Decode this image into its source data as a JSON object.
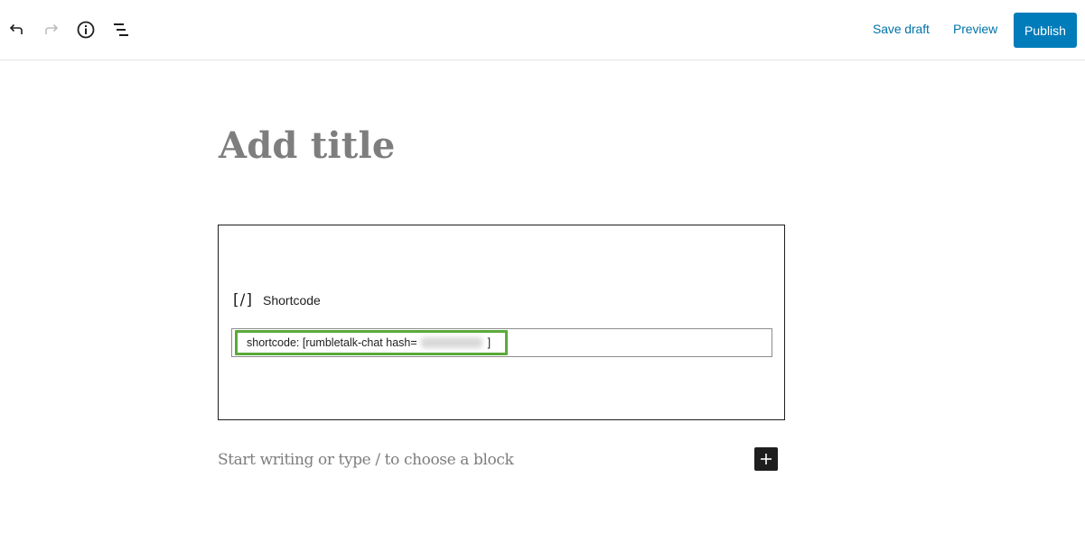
{
  "toolbar": {
    "left_icons": [
      "undo-icon",
      "redo-icon",
      "info-icon",
      "block-navigation-icon"
    ],
    "save_draft_label": "Save draft",
    "preview_label": "Preview",
    "publish_label": "Publish",
    "accent_color": "#007cba",
    "link_color": "#0073aa"
  },
  "editor": {
    "title_placeholder": "Add title",
    "shortcode_block": {
      "icon": "[/]",
      "label": "Shortcode",
      "value_prefix": "shortcode: [rumbletalk-chat hash=",
      "value_hash_obscured": true,
      "value_suffix": "]",
      "highlight_color": "#5aaa3a"
    },
    "paragraph_placeholder": "Start writing or type / to choose a block",
    "add_block_icon": "plus-icon"
  }
}
